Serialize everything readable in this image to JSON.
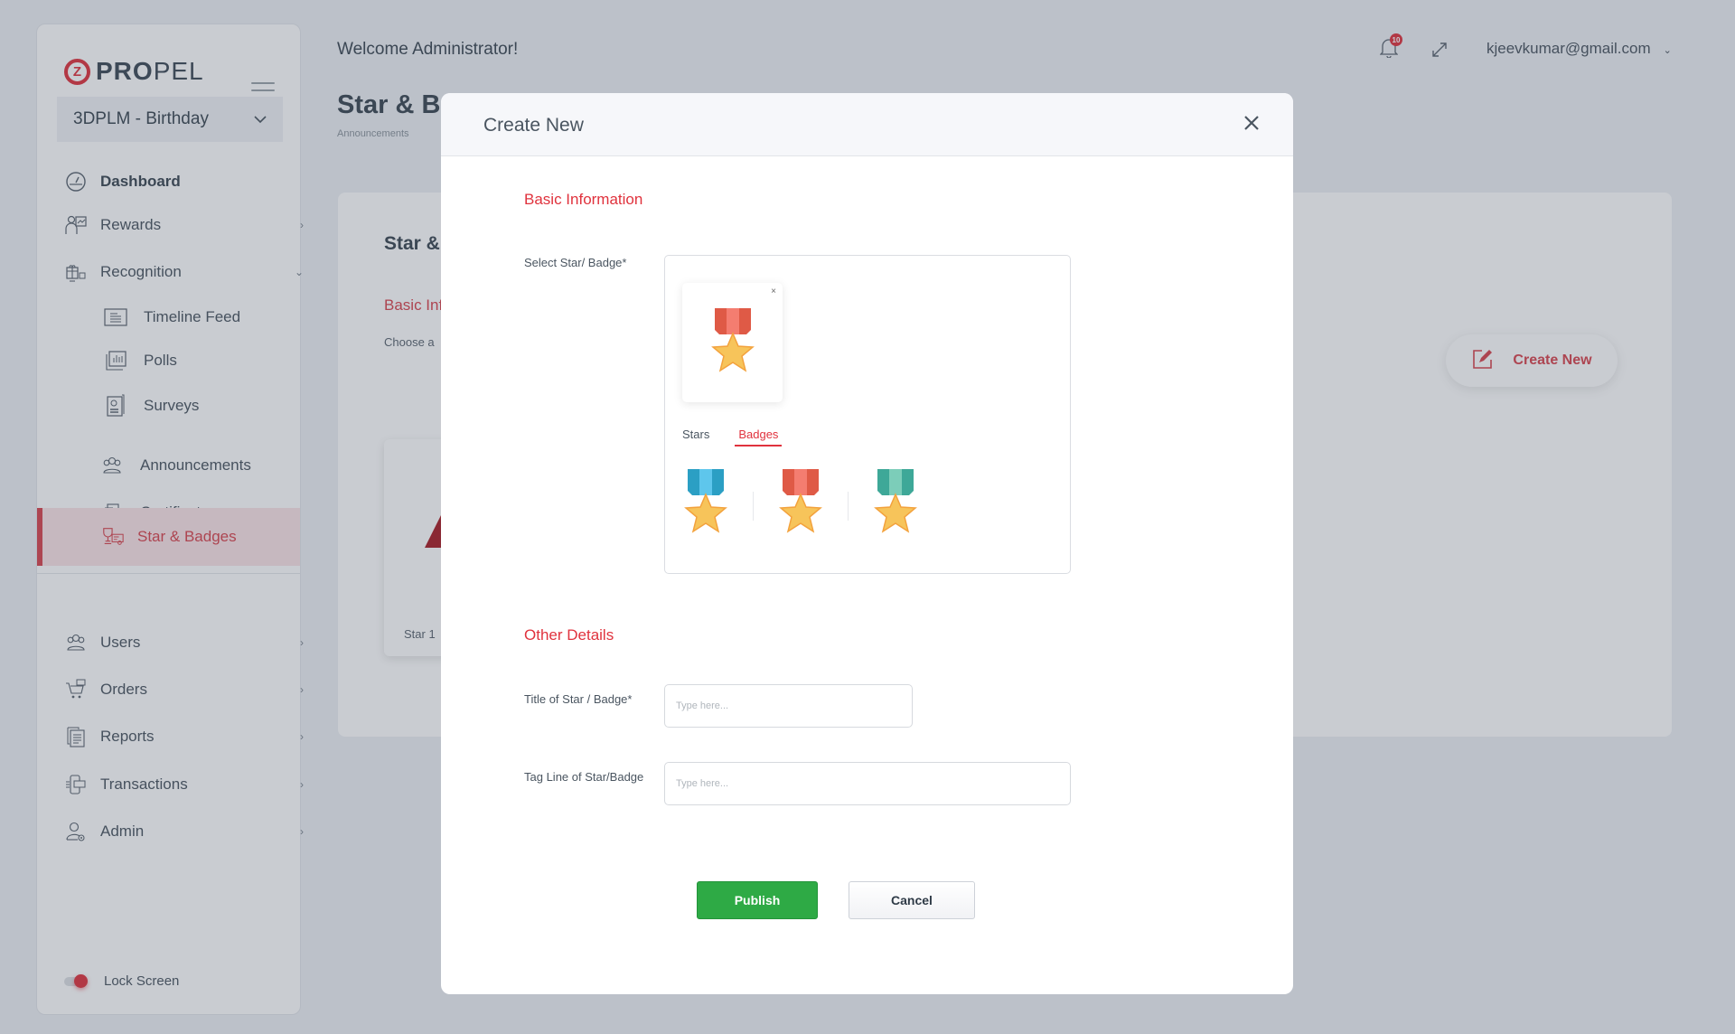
{
  "app": {
    "brand_bold": "PRO",
    "brand_light": "PEL"
  },
  "sidebar": {
    "program_select": "3DPLM - Birthday",
    "items": [
      {
        "label": "Dashboard",
        "icon": "dashboard-gauge-icon"
      },
      {
        "label": "Rewards",
        "icon": "rewards-presenter-icon",
        "chevron": "›"
      },
      {
        "label": "Recognition",
        "icon": "gift-icon",
        "chevron": "⌄"
      },
      {
        "label": "Timeline Feed",
        "icon": "timeline-icon"
      },
      {
        "label": "Polls",
        "icon": "polls-chart-icon"
      },
      {
        "label": "Surveys",
        "icon": "survey-doc-icon"
      },
      {
        "label": "Announcements",
        "icon": "group-icon"
      },
      {
        "label": "Certificates",
        "icon": "certificate-icon"
      },
      {
        "label": "Star & Badges",
        "icon": "trophy-icon",
        "active": true
      },
      {
        "label": "Users",
        "icon": "users-icon",
        "chevron": "›"
      },
      {
        "label": "Orders",
        "icon": "cart-icon",
        "chevron": "›"
      },
      {
        "label": "Reports",
        "icon": "reports-icon",
        "chevron": "›"
      },
      {
        "label": "Transactions",
        "icon": "transactions-icon",
        "chevron": "›"
      },
      {
        "label": "Admin",
        "icon": "admin-icon",
        "chevron": "›"
      }
    ],
    "lock_screen": "Lock Screen"
  },
  "topbar": {
    "welcome": "Welcome Administrator!",
    "notification_count": "10",
    "user_email": "kjeevkumar@gmail.com",
    "user_caret": "⌄"
  },
  "page": {
    "title": "Star & Badges",
    "breadcrumb": "Announcements",
    "card_title": "Star & Badges",
    "section": "Basic Information",
    "subtitle": "Choose a",
    "star_card_label": "Star  1",
    "create_new": "Create New"
  },
  "modal": {
    "title": "Create New",
    "close": "✕",
    "basic_info": "Basic Information",
    "select_label": "Select Star/ Badge*",
    "selected_remove": "×",
    "tabs": [
      {
        "label": "Stars",
        "active": false
      },
      {
        "label": "Badges",
        "active": true
      }
    ],
    "badges": [
      {
        "name": "blue",
        "ribbon_dark": "#2b9fc4",
        "ribbon_light": "#5ec6ec"
      },
      {
        "name": "red",
        "ribbon_dark": "#df5a46",
        "ribbon_light": "#f47d70"
      },
      {
        "name": "teal",
        "ribbon_dark": "#3ea898",
        "ribbon_light": "#7ccdb9"
      }
    ],
    "selected_badge": "red",
    "other_details": "Other Details",
    "title_label": "Title of Star / Badge*",
    "title_placeholder": "Type here...",
    "title_value": "",
    "tagline_label": "Tag Line of Star/Badge",
    "tagline_placeholder": "Type here...",
    "tagline_value": "",
    "publish": "Publish",
    "cancel": "Cancel"
  },
  "colors": {
    "accent": "#e0323d",
    "publish": "#2eaa45"
  }
}
